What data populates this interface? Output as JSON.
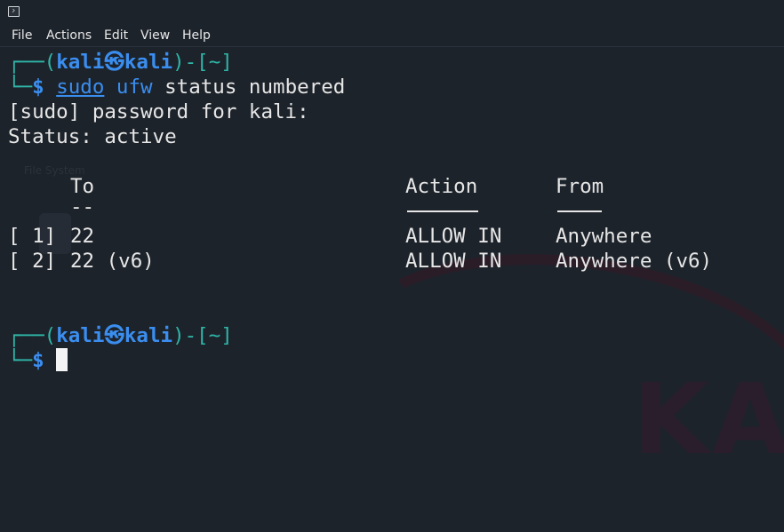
{
  "menu": [
    "File",
    "Actions",
    "Edit",
    "View",
    "Help"
  ],
  "prompt": {
    "open": "┌──(",
    "user": "kali",
    "at_symbol": "㉿",
    "host": "kali",
    "close_dir": ")-[~]",
    "corner": "└─",
    "dollar": "$"
  },
  "command": {
    "sudo": "sudo",
    "ufw": "ufw",
    "args": "status numbered"
  },
  "output": {
    "sudo_line": "[sudo] password for kali:",
    "status_line": "Status: active",
    "header_to": "To",
    "header_action": "Action",
    "header_from": "From",
    "dash_to": "--",
    "dash_action": "------",
    "dash_from": "----",
    "rules": [
      {
        "num": "[ 1]",
        "to": "22",
        "action": "ALLOW IN",
        "from": "Anywhere"
      },
      {
        "num": "[ 2]",
        "to": "22 (v6)",
        "action": "ALLOW IN",
        "from": "Anywhere (v6)"
      }
    ]
  },
  "background": {
    "desktop_label": "File System",
    "watermark": "KALI"
  },
  "colors": {
    "background": "#1d232b",
    "prompt_box": "#2fb6a8",
    "prompt_user": "#3a8ef0",
    "text": "#e6e6e6"
  }
}
